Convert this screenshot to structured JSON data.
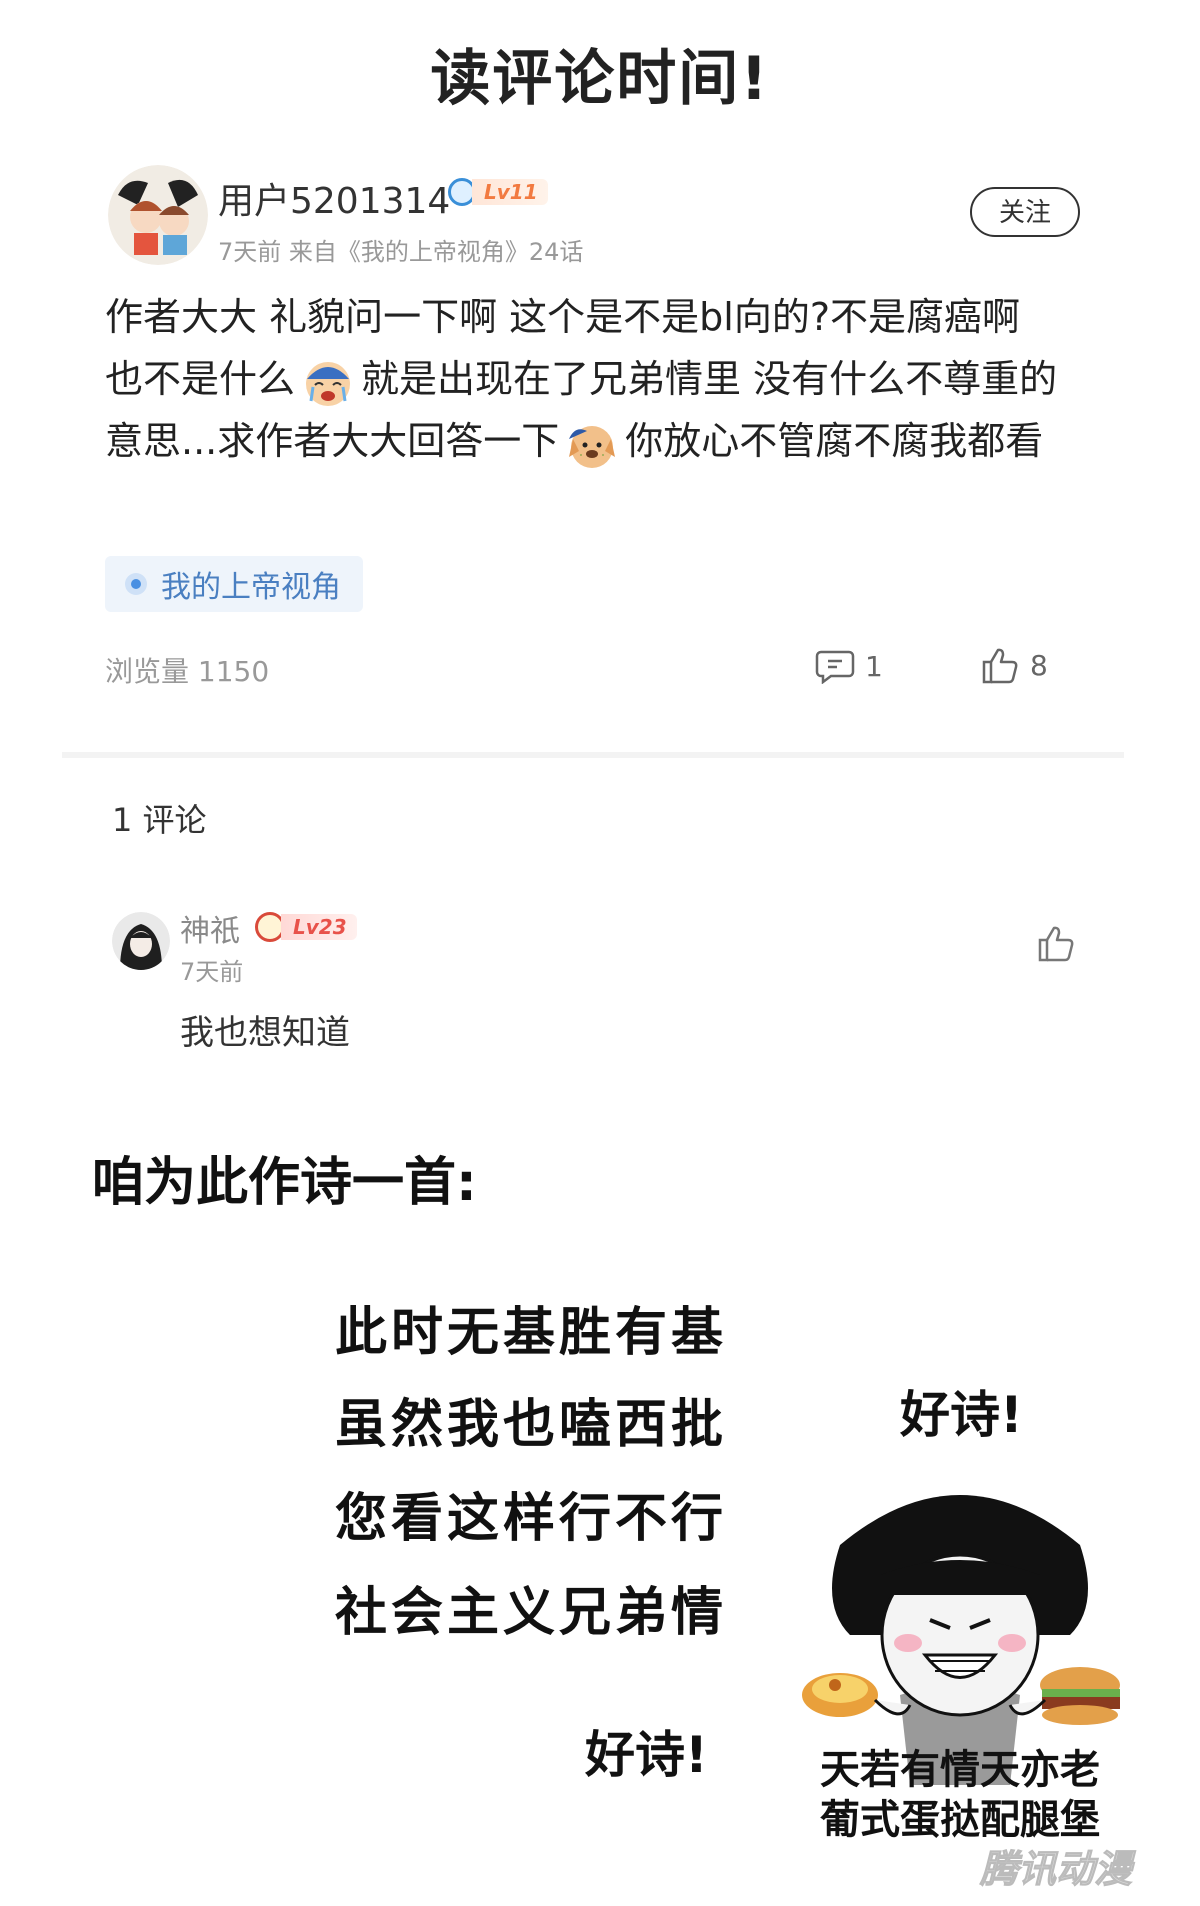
{
  "page_title": "读评论时间!",
  "post": {
    "username": "用户5201314",
    "level": "Lv11",
    "meta": "7天前 来自《我的上帝视角》24话",
    "follow_label": "关注",
    "body_parts": [
      "作者大大 礼貌问一下啊 这个是不是bl向的?不是腐癌啊 也不是什么",
      "就是出现在了兄弟情里 没有什么不尊重的意思...求作者大大回答一下",
      "你放心不管腐不腐我都看"
    ],
    "emojis": [
      "crying-emoji",
      "dog-emoji"
    ],
    "topic": "我的上帝视角",
    "views": "浏览量 1150",
    "comments": "1",
    "likes": "8"
  },
  "comments_section": {
    "header": "1 评论",
    "items": [
      {
        "name": "神祇",
        "level": "Lv23",
        "time": "7天前",
        "text": "我也想知道"
      }
    ]
  },
  "poem": {
    "intro": "咱为此作诗一首:",
    "lines": [
      "此时无基胜有基",
      "虽然我也嗑西批",
      "您看这样行不行",
      "社会主义兄弟情"
    ],
    "good_poem_1": "好诗!",
    "good_poem_2": "好诗!"
  },
  "meme": {
    "caption_line1": "天若有情天亦老",
    "caption_line2": "葡式蛋挞配腿堡"
  },
  "watermark": "腾讯动漫",
  "colors": {
    "accent_blue": "#4a90e2",
    "level_orange": "#f27a40",
    "level_red": "#e8524a"
  }
}
